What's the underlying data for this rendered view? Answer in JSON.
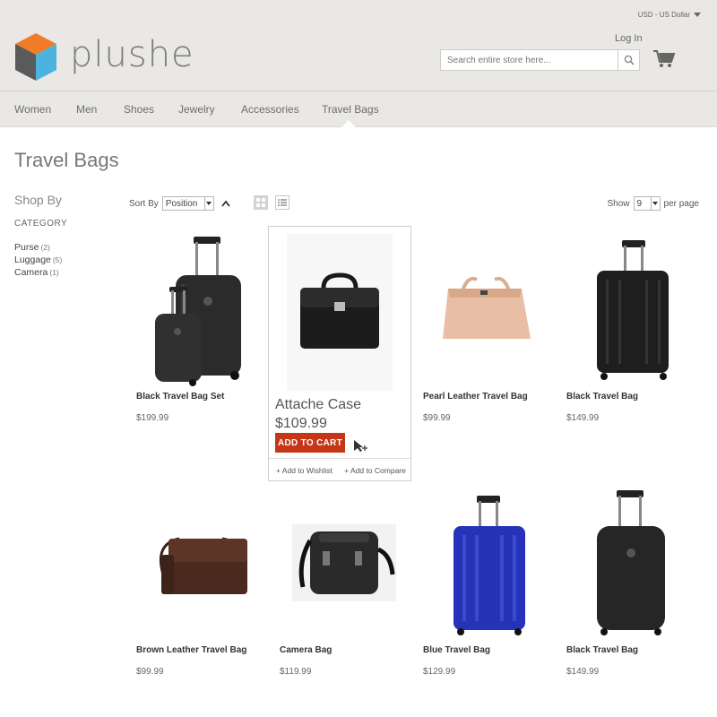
{
  "brand": {
    "name": "plushe",
    "colors": {
      "orange": "#f07c28",
      "blue": "#4ab3de",
      "dark": "#555555"
    }
  },
  "header": {
    "currency": "USD - US Dollar",
    "login": "Log In",
    "search_placeholder": "Search entire store here...",
    "icons": [
      "search-icon",
      "cart-icon"
    ]
  },
  "nav": [
    {
      "label": "Women"
    },
    {
      "label": "Men"
    },
    {
      "label": "Shoes"
    },
    {
      "label": "Jewelry"
    },
    {
      "label": "Accessories"
    },
    {
      "label": "Travel Bags",
      "active": true
    }
  ],
  "page": {
    "title": "Travel Bags"
  },
  "sidebar": {
    "heading": "Shop By",
    "category_heading": "CATEGORY",
    "categories": [
      {
        "label": "Purse",
        "count": "(2)"
      },
      {
        "label": "Luggage",
        "count": "(5)"
      },
      {
        "label": "Camera",
        "count": "(1)"
      }
    ]
  },
  "toolbar": {
    "sort_label": "Sort By",
    "sort_value": "Position",
    "show_label": "Show",
    "show_value": "9",
    "per_page_label": "per page"
  },
  "products": [
    {
      "name": "Black Travel Bag Set",
      "price": "$199.99"
    },
    {
      "name": "Attache Case",
      "price": "$109.99"
    },
    {
      "name": "Pearl Leather Travel Bag",
      "price": "$99.99"
    },
    {
      "name": "Black Travel Bag",
      "price": "$149.99"
    },
    {
      "name": "Brown Leather Travel Bag",
      "price": "$99.99"
    },
    {
      "name": "Camera Bag",
      "price": "$119.99"
    },
    {
      "name": "Blue Travel Bag",
      "price": "$129.99"
    },
    {
      "name": "Black Travel Bag",
      "price": "$149.99"
    }
  ],
  "hover": {
    "add_to_cart": "ADD TO CART",
    "add_to_wishlist": "+ Add to Wishlist",
    "add_to_compare": "+ Add to Compare"
  }
}
